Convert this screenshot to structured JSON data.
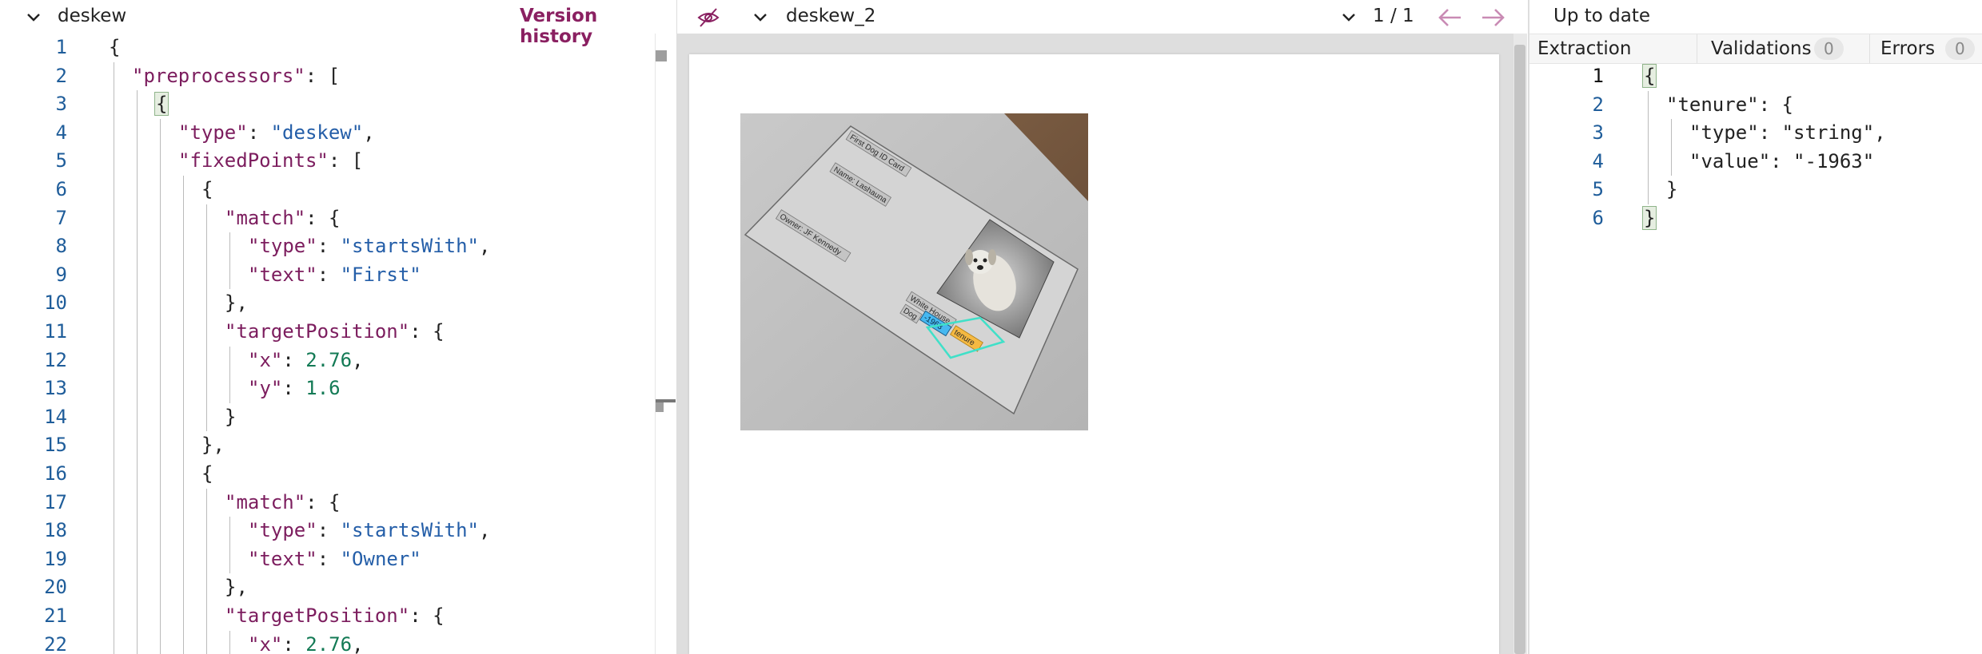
{
  "left_panel": {
    "title": "deskew",
    "version_history_label": "Version history",
    "lines": [
      {
        "n": "1",
        "indent": 0,
        "tokens": [
          {
            "t": "p",
            "v": "{"
          }
        ]
      },
      {
        "n": "2",
        "indent": 1,
        "tokens": [
          {
            "t": "k",
            "v": "\"preprocessors\""
          },
          {
            "t": "p",
            "v": ": ["
          }
        ]
      },
      {
        "n": "3",
        "indent": 2,
        "tokens": [
          {
            "t": "b",
            "v": "{"
          }
        ]
      },
      {
        "n": "4",
        "indent": 3,
        "tokens": [
          {
            "t": "k",
            "v": "\"type\""
          },
          {
            "t": "p",
            "v": ": "
          },
          {
            "t": "s",
            "v": "\"deskew\""
          },
          {
            "t": "p",
            "v": ","
          }
        ]
      },
      {
        "n": "5",
        "indent": 3,
        "tokens": [
          {
            "t": "k",
            "v": "\"fixedPoints\""
          },
          {
            "t": "p",
            "v": ": ["
          }
        ]
      },
      {
        "n": "6",
        "indent": 4,
        "tokens": [
          {
            "t": "p",
            "v": "{"
          }
        ]
      },
      {
        "n": "7",
        "indent": 5,
        "tokens": [
          {
            "t": "k",
            "v": "\"match\""
          },
          {
            "t": "p",
            "v": ": {"
          }
        ]
      },
      {
        "n": "8",
        "indent": 6,
        "tokens": [
          {
            "t": "k",
            "v": "\"type\""
          },
          {
            "t": "p",
            "v": ": "
          },
          {
            "t": "s",
            "v": "\"startsWith\""
          },
          {
            "t": "p",
            "v": ","
          }
        ]
      },
      {
        "n": "9",
        "indent": 6,
        "tokens": [
          {
            "t": "k",
            "v": "\"text\""
          },
          {
            "t": "p",
            "v": ": "
          },
          {
            "t": "s",
            "v": "\"First\""
          }
        ]
      },
      {
        "n": "10",
        "indent": 5,
        "tokens": [
          {
            "t": "p",
            "v": "},"
          }
        ]
      },
      {
        "n": "11",
        "indent": 5,
        "tokens": [
          {
            "t": "k",
            "v": "\"targetPosition\""
          },
          {
            "t": "p",
            "v": ": {"
          }
        ]
      },
      {
        "n": "12",
        "indent": 6,
        "tokens": [
          {
            "t": "k",
            "v": "\"x\""
          },
          {
            "t": "p",
            "v": ": "
          },
          {
            "t": "n",
            "v": "2.76"
          },
          {
            "t": "p",
            "v": ","
          }
        ]
      },
      {
        "n": "13",
        "indent": 6,
        "tokens": [
          {
            "t": "k",
            "v": "\"y\""
          },
          {
            "t": "p",
            "v": ": "
          },
          {
            "t": "n",
            "v": "1.6"
          }
        ]
      },
      {
        "n": "14",
        "indent": 5,
        "tokens": [
          {
            "t": "p",
            "v": "}"
          }
        ]
      },
      {
        "n": "15",
        "indent": 4,
        "tokens": [
          {
            "t": "p",
            "v": "},"
          }
        ]
      },
      {
        "n": "16",
        "indent": 4,
        "tokens": [
          {
            "t": "p",
            "v": "{"
          }
        ]
      },
      {
        "n": "17",
        "indent": 5,
        "tokens": [
          {
            "t": "k",
            "v": "\"match\""
          },
          {
            "t": "p",
            "v": ": {"
          }
        ]
      },
      {
        "n": "18",
        "indent": 6,
        "tokens": [
          {
            "t": "k",
            "v": "\"type\""
          },
          {
            "t": "p",
            "v": ": "
          },
          {
            "t": "s",
            "v": "\"startsWith\""
          },
          {
            "t": "p",
            "v": ","
          }
        ]
      },
      {
        "n": "19",
        "indent": 6,
        "tokens": [
          {
            "t": "k",
            "v": "\"text\""
          },
          {
            "t": "p",
            "v": ": "
          },
          {
            "t": "s",
            "v": "\"Owner\""
          }
        ]
      },
      {
        "n": "20",
        "indent": 5,
        "tokens": [
          {
            "t": "p",
            "v": "},"
          }
        ]
      },
      {
        "n": "21",
        "indent": 5,
        "tokens": [
          {
            "t": "k",
            "v": "\"targetPosition\""
          },
          {
            "t": "p",
            "v": ": {"
          }
        ]
      },
      {
        "n": "22",
        "indent": 6,
        "tokens": [
          {
            "t": "k",
            "v": "\"x\""
          },
          {
            "t": "p",
            "v": ": "
          },
          {
            "t": "n",
            "v": "2.76"
          },
          {
            "t": "p",
            "v": ","
          }
        ]
      }
    ]
  },
  "preview_panel": {
    "title": "deskew_2",
    "page_indicator": "1 / 1",
    "icons": {
      "visibility": "eye-off-icon",
      "prev": "arrow-left-icon",
      "next": "arrow-right-icon"
    },
    "document": {
      "card_labels": [
        "First Dog ID Card",
        "Name: Lashauna",
        "Owner: JF Kennedy",
        "White House",
        "Dog",
        "tenure",
        "-1963"
      ]
    },
    "colors": {
      "match_box": "#40e0c8",
      "highlight_orange": "#f5b942",
      "highlight_blue": "#46b8f0"
    }
  },
  "extraction_panel": {
    "status": "Up to date",
    "tabs": [
      {
        "label": "Extraction",
        "active": true
      },
      {
        "label": "Validations",
        "count": "0"
      },
      {
        "label": "Errors",
        "count": "0"
      }
    ],
    "lines": [
      {
        "n": "1",
        "indent": 0,
        "tokens": [
          {
            "t": "b",
            "v": "{"
          }
        ]
      },
      {
        "n": "2",
        "indent": 1,
        "tokens": [
          {
            "t": "p",
            "v": "\"tenure\": {"
          }
        ]
      },
      {
        "n": "3",
        "indent": 2,
        "tokens": [
          {
            "t": "p",
            "v": "\"type\": \"string\","
          }
        ]
      },
      {
        "n": "4",
        "indent": 2,
        "tokens": [
          {
            "t": "p",
            "v": "\"value\": \"-1963\""
          }
        ]
      },
      {
        "n": "5",
        "indent": 1,
        "tokens": [
          {
            "t": "p",
            "v": "}"
          }
        ]
      },
      {
        "n": "6",
        "indent": 0,
        "tokens": [
          {
            "t": "b",
            "v": "}"
          }
        ]
      }
    ]
  },
  "colors": {
    "accent": "#8a2061",
    "json_key": "#7c1d5e",
    "json_string": "#245ea8",
    "json_number": "#137a55",
    "line_number": "#1f5d9a"
  }
}
